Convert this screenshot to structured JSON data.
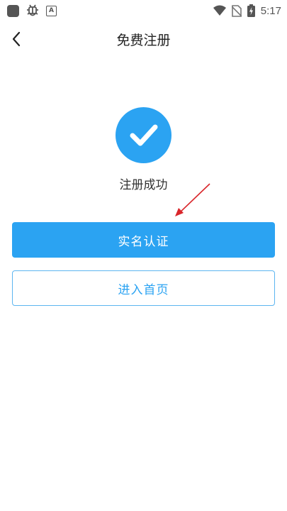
{
  "status_bar": {
    "time": "5:17",
    "left_icons": [
      "app-square-icon",
      "bug-icon",
      "a-box-icon"
    ],
    "right_icons": [
      "wifi-icon",
      "no-sim-icon",
      "battery-charging-icon"
    ]
  },
  "header": {
    "title": "免费注册",
    "back_icon": "chevron-left-icon"
  },
  "success": {
    "icon": "checkmark-icon",
    "text": "注册成功"
  },
  "buttons": {
    "verify_label": "实名认证",
    "home_label": "进入首页"
  },
  "colors": {
    "accent": "#2ba3f2",
    "annotation_arrow": "#d9262b"
  }
}
